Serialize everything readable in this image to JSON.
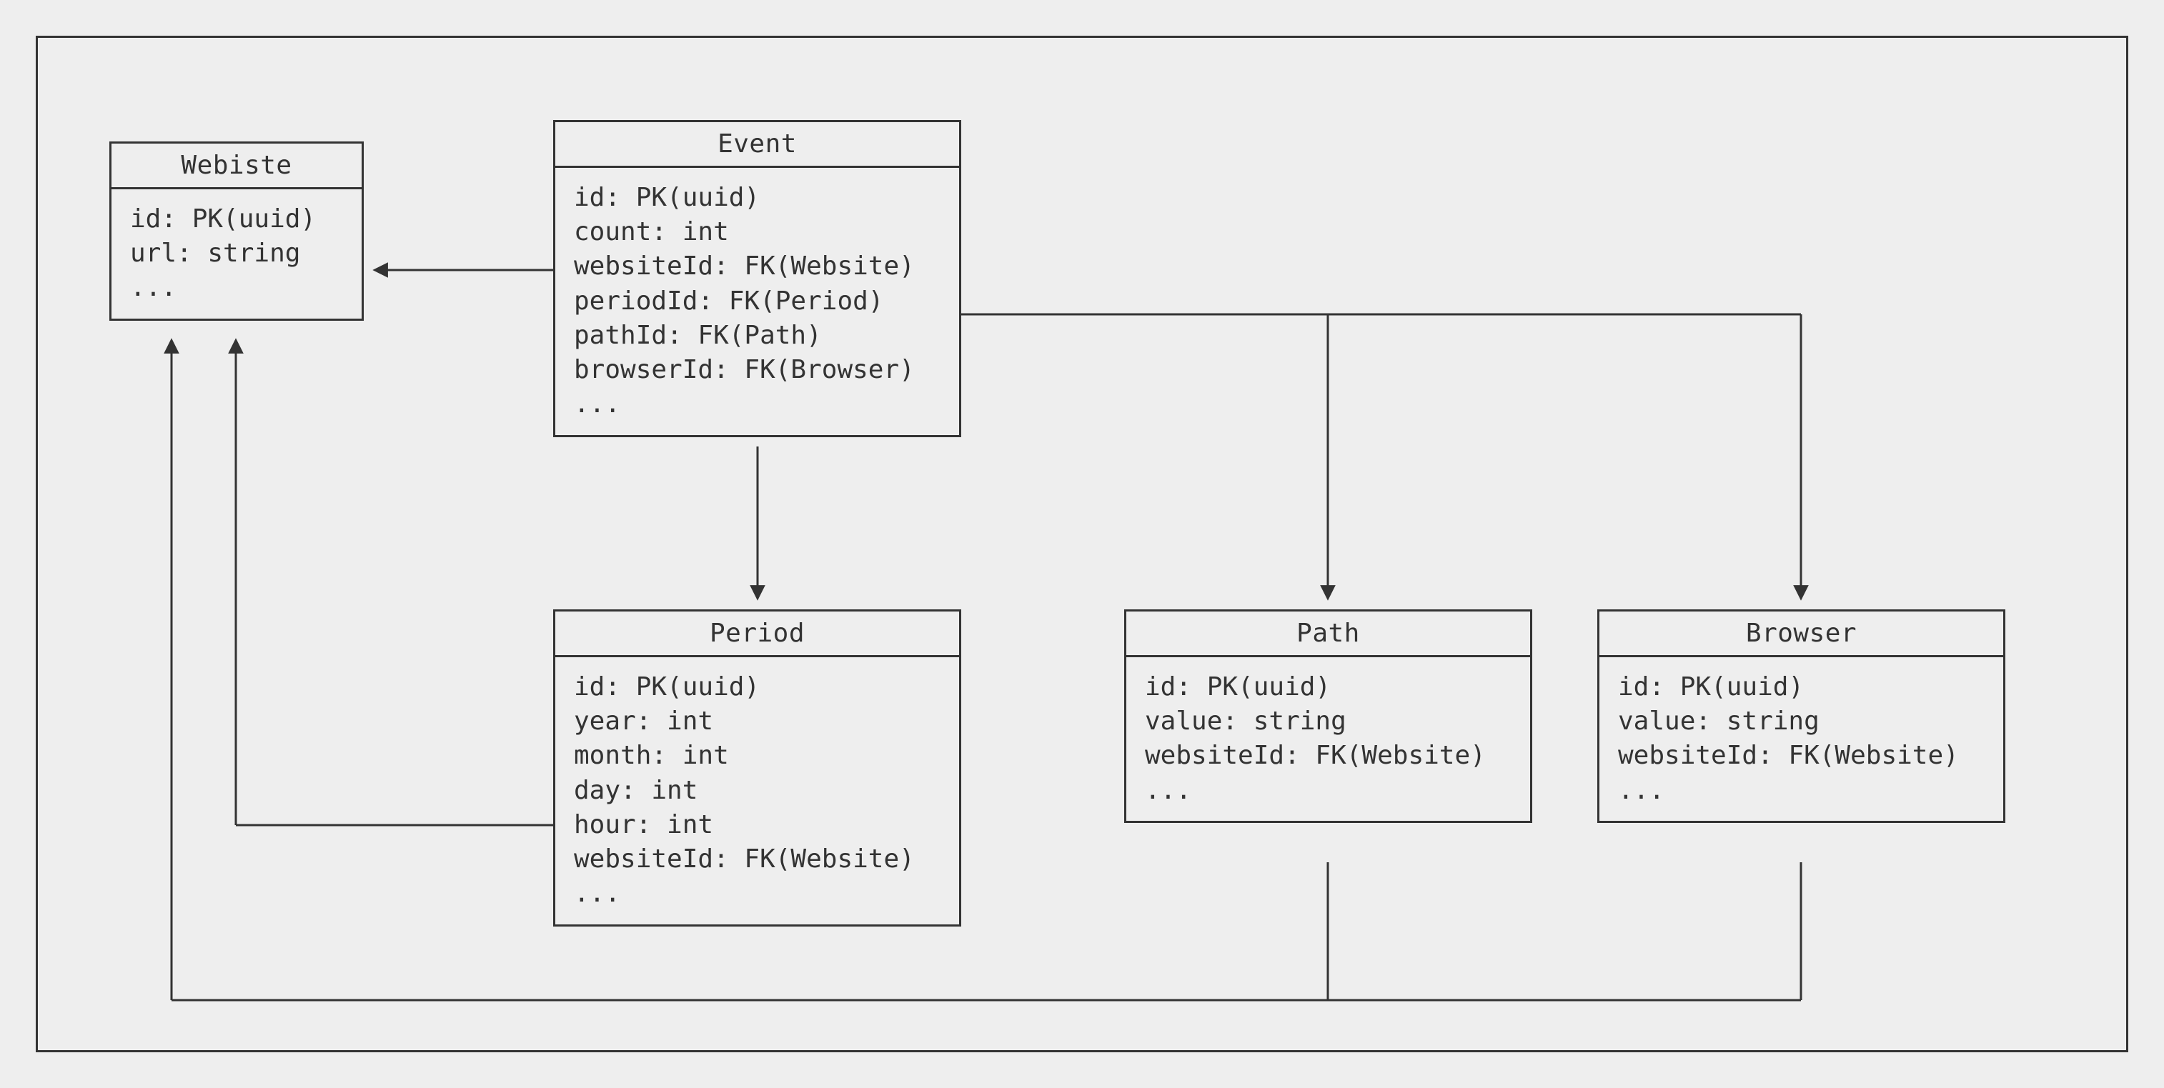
{
  "entities": {
    "website": {
      "title": "Webiste",
      "fields": [
        "id: PK(uuid)",
        "url: string",
        "..."
      ]
    },
    "event": {
      "title": "Event",
      "fields": [
        "id: PK(uuid)",
        "count: int",
        "websiteId: FK(Website)",
        "periodId: FK(Period)",
        "pathId: FK(Path)",
        "browserId: FK(Browser)",
        "..."
      ]
    },
    "period": {
      "title": "Period",
      "fields": [
        "id: PK(uuid)",
        "year: int",
        "month: int",
        "day: int",
        "hour: int",
        "websiteId: FK(Website)",
        "..."
      ]
    },
    "path": {
      "title": "Path",
      "fields": [
        "id: PK(uuid)",
        "value: string",
        "websiteId: FK(Website)",
        "..."
      ]
    },
    "browser": {
      "title": "Browser",
      "fields": [
        "id: PK(uuid)",
        "value: string",
        "websiteId: FK(Website)",
        "..."
      ]
    }
  },
  "relationships": [
    {
      "from": "Event",
      "to": "Website",
      "via": "websiteId"
    },
    {
      "from": "Event",
      "to": "Period",
      "via": "periodId"
    },
    {
      "from": "Event",
      "to": "Path",
      "via": "pathId"
    },
    {
      "from": "Event",
      "to": "Browser",
      "via": "browserId"
    },
    {
      "from": "Period",
      "to": "Website",
      "via": "websiteId"
    },
    {
      "from": "Path",
      "to": "Website",
      "via": "websiteId"
    },
    {
      "from": "Browser",
      "to": "Website",
      "via": "websiteId"
    }
  ]
}
